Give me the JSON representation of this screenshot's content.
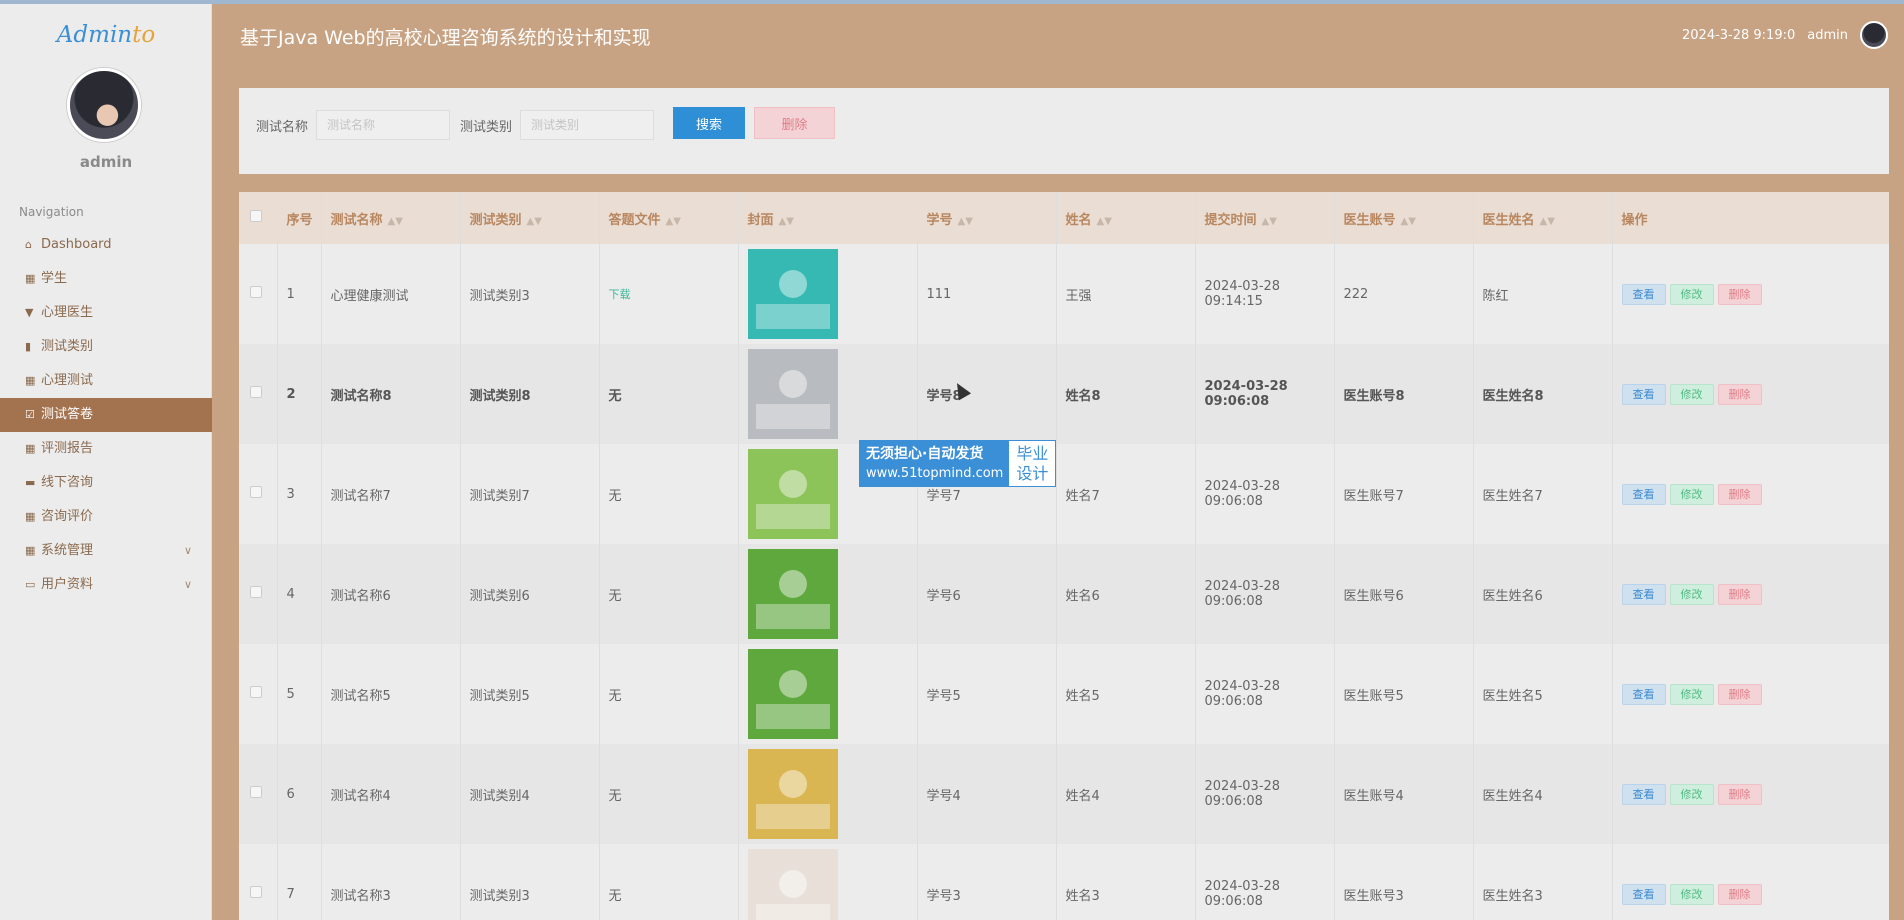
{
  "app": {
    "logo_main": "Admin",
    "logo_accent": "to",
    "title": "基于Java Web的高校心理咨询系统的设计和实现",
    "datetime": "2024-3-28 9:19:0",
    "user": "admin"
  },
  "sidebar": {
    "username": "admin",
    "nav_title": "Navigation",
    "items": [
      {
        "label": "Dashboard",
        "icon": "home-icon",
        "glyph": "⌂"
      },
      {
        "label": "学生",
        "icon": "grid-icon",
        "glyph": "▦"
      },
      {
        "label": "心理医生",
        "icon": "pin-icon",
        "glyph": "▼"
      },
      {
        "label": "测试类别",
        "icon": "bar-chart-icon",
        "glyph": "▮"
      },
      {
        "label": "心理测试",
        "icon": "grid-icon",
        "glyph": "▦"
      },
      {
        "label": "测试答卷",
        "icon": "checkbox-icon",
        "glyph": "☑"
      },
      {
        "label": "评测报告",
        "icon": "table-icon",
        "glyph": "▦"
      },
      {
        "label": "线下咨询",
        "icon": "ticket-icon",
        "glyph": "▬"
      },
      {
        "label": "咨询评价",
        "icon": "table-icon",
        "glyph": "▦"
      },
      {
        "label": "系统管理",
        "icon": "grid-icon",
        "glyph": "▦"
      },
      {
        "label": "用户资料",
        "icon": "window-icon",
        "glyph": "▭"
      }
    ],
    "active_index": 5
  },
  "search": {
    "name_label": "测试名称",
    "name_placeholder": "测试名称",
    "type_label": "测试类别",
    "type_placeholder": "测试类别",
    "search_button": "搜索",
    "delete_button": "删除"
  },
  "table": {
    "columns": [
      "序号",
      "测试名称",
      "测试类别",
      "答题文件",
      "封面",
      "学号",
      "姓名",
      "提交时间",
      "医生账号",
      "医生姓名",
      "操作"
    ],
    "actions": {
      "view": "查看",
      "edit": "修改",
      "delete": "删除"
    },
    "rows": [
      {
        "no": "1",
        "name": "心理健康测试",
        "type": "测试类别3",
        "file": "下载",
        "student_id": "111",
        "student_name": "王强",
        "time": "2024-03-28 09:14:15",
        "doctor_id": "222",
        "doctor_name": "陈红",
        "cover_color": "#35b9b2"
      },
      {
        "no": "2",
        "name": "测试名称8",
        "type": "测试类别8",
        "file": "无",
        "student_id": "学号8",
        "student_name": "姓名8",
        "time": "2024-03-28 09:06:08",
        "doctor_id": "医生账号8",
        "doctor_name": "医生姓名8",
        "cover_color": "#b8bcc0"
      },
      {
        "no": "3",
        "name": "测试名称7",
        "type": "测试类别7",
        "file": "无",
        "student_id": "学号7",
        "student_name": "姓名7",
        "time": "2024-03-28 09:06:08",
        "doctor_id": "医生账号7",
        "doctor_name": "医生姓名7",
        "cover_color": "#8cc45a"
      },
      {
        "no": "4",
        "name": "测试名称6",
        "type": "测试类别6",
        "file": "无",
        "student_id": "学号6",
        "student_name": "姓名6",
        "time": "2024-03-28 09:06:08",
        "doctor_id": "医生账号6",
        "doctor_name": "医生姓名6",
        "cover_color": "#5fa83e"
      },
      {
        "no": "5",
        "name": "测试名称5",
        "type": "测试类别5",
        "file": "无",
        "student_id": "学号5",
        "student_name": "姓名5",
        "time": "2024-03-28 09:06:08",
        "doctor_id": "医生账号5",
        "doctor_name": "医生姓名5",
        "cover_color": "#5fa83e"
      },
      {
        "no": "6",
        "name": "测试名称4",
        "type": "测试类别4",
        "file": "无",
        "student_id": "学号4",
        "student_name": "姓名4",
        "time": "2024-03-28 09:06:08",
        "doctor_id": "医生账号4",
        "doctor_name": "医生姓名4",
        "cover_color": "#d9b652"
      },
      {
        "no": "7",
        "name": "测试名称3",
        "type": "测试类别3",
        "file": "无",
        "student_id": "学号3",
        "student_name": "姓名3",
        "time": "2024-03-28 09:06:08",
        "doctor_id": "医生账号3",
        "doctor_name": "医生姓名3",
        "cover_color": "#e8e0d8"
      }
    ]
  },
  "watermark": {
    "line1": "无须担心·自动发货",
    "line2": "www.51topmind.com",
    "badge1": "毕业",
    "badge2": "设计"
  }
}
